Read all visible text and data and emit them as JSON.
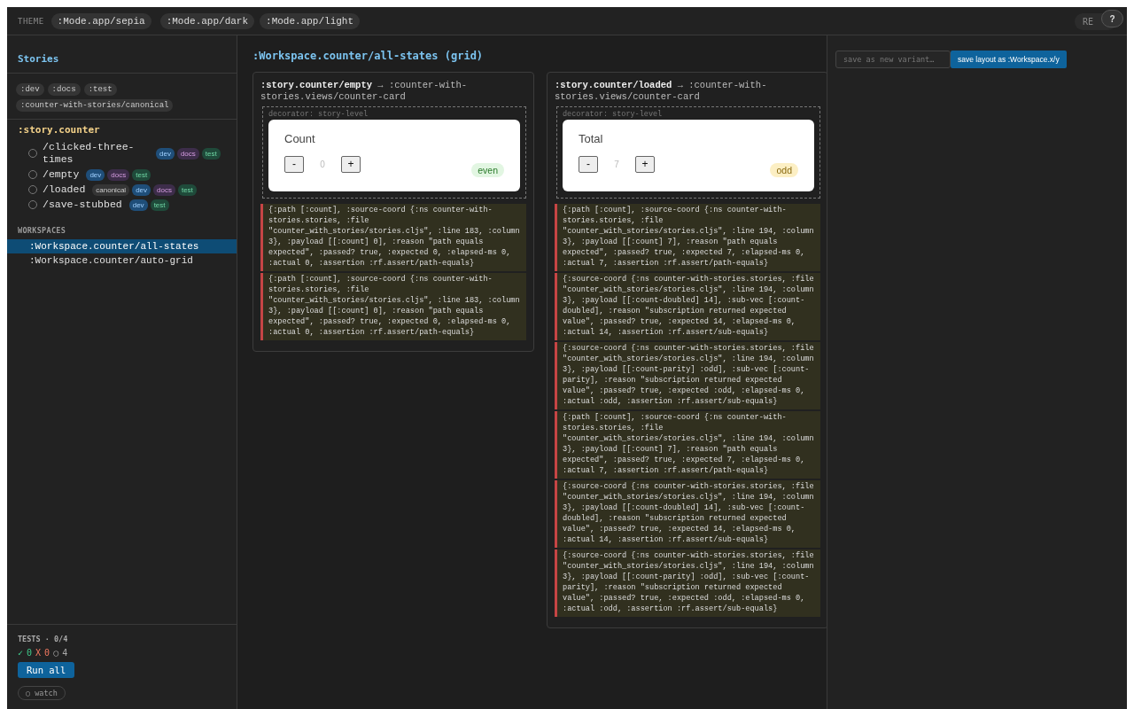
{
  "topbar": {
    "theme_label": "THEME",
    "modes": [
      ":Mode.app/sepia",
      ":Mode.app/dark",
      ":Mode.app/light"
    ],
    "re_button": "RE",
    "help_button": "?"
  },
  "sidebar": {
    "title": "Stories",
    "tags": [
      ":dev",
      ":docs",
      ":test",
      ":counter-with-stories/canonical"
    ],
    "group": ":story.counter",
    "stories": [
      {
        "name": "/clicked-three-times",
        "selected": false,
        "tags": [
          {
            "label": "dev",
            "kind": "dev"
          },
          {
            "label": "docs",
            "kind": "docs"
          },
          {
            "label": "test",
            "kind": "test"
          }
        ]
      },
      {
        "name": "/empty",
        "selected": false,
        "tags": [
          {
            "label": "dev",
            "kind": "dev"
          },
          {
            "label": "docs",
            "kind": "docs"
          },
          {
            "label": "test",
            "kind": "test"
          }
        ]
      },
      {
        "name": "/loaded",
        "selected": false,
        "tags": [
          {
            "label": "canonical",
            "kind": "canonical"
          },
          {
            "label": "dev",
            "kind": "dev"
          },
          {
            "label": "docs",
            "kind": "docs"
          },
          {
            "label": "test",
            "kind": "test"
          }
        ]
      },
      {
        "name": "/save-stubbed",
        "selected": false,
        "tags": [
          {
            "label": "dev",
            "kind": "dev"
          },
          {
            "label": "test",
            "kind": "test"
          }
        ]
      }
    ],
    "workspaces_label": "WORKSPACES",
    "workspaces": [
      {
        "label": ":Workspace.counter/all-states",
        "selected": true
      },
      {
        "label": ":Workspace.counter/auto-grid",
        "selected": false
      }
    ],
    "tests": {
      "title": "TESTS · 0/4",
      "counts": [
        {
          "kind": "pass",
          "symbol": "✓",
          "count": "0"
        },
        {
          "kind": "fail",
          "symbol": "X",
          "count": "0"
        },
        {
          "kind": "pending",
          "symbol": "○",
          "count": "4"
        }
      ],
      "run_button": "Run all",
      "watch_button": "○ watch"
    }
  },
  "main": {
    "title": ":Workspace.counter/all-states (grid)",
    "cards": [
      {
        "heading": "**:story.counter/empty** → :counter-with-stories.views/counter-card",
        "decorator": "decorator: story-level",
        "counter": {
          "label": "Count",
          "minus": "-",
          "value": "0",
          "plus": "+",
          "parity": "even",
          "kind": "even"
        },
        "logs": [
          "{:path [:count], :source-coord {:ns counter-with-stories.stories, :file \"counter_with_stories/stories.cljs\", :line 183, :column 3}, :payload [[:count] 0], :reason \"path equals expected\", :passed? true, :expected 0, :elapsed-ms 0, :actual 0, :assertion :rf.assert/path-equals}",
          "{:path [:count], :source-coord {:ns counter-with-stories.stories, :file \"counter_with_stories/stories.cljs\", :line 183, :column 3}, :payload [[:count] 0], :reason \"path equals expected\", :passed? true, :expected 0, :elapsed-ms 0, :actual 0, :assertion :rf.assert/path-equals}"
        ]
      },
      {
        "heading": "**:story.counter/loaded** → :counter-with-stories.views/counter-card",
        "decorator": "decorator: story-level",
        "counter": {
          "label": "Total",
          "minus": "-",
          "value": "7",
          "plus": "+",
          "parity": "odd",
          "kind": "odd"
        },
        "logs": [
          "{:path [:count], :source-coord {:ns counter-with-stories.stories, :file \"counter_with_stories/stories.cljs\", :line 194, :column 3}, :payload [[:count] 7], :reason \"path equals expected\", :passed? true, :expected 7, :elapsed-ms 0, :actual 7, :assertion :rf.assert/path-equals}",
          "{:source-coord {:ns counter-with-stories.stories, :file \"counter_with_stories/stories.cljs\", :line 194, :column 3}, :payload [[:count-doubled] 14], :sub-vec [:count-doubled], :reason \"subscription returned expected value\", :passed? true, :expected 14, :elapsed-ms 0, :actual 14, :assertion :rf.assert/sub-equals}",
          "{:source-coord {:ns counter-with-stories.stories, :file \"counter_with_stories/stories.cljs\", :line 194, :column 3}, :payload [[:count-parity] :odd], :sub-vec [:count-parity], :reason \"subscription returned expected value\", :passed? true, :expected :odd, :elapsed-ms 0, :actual :odd, :assertion :rf.assert/sub-equals}",
          "{:path [:count], :source-coord {:ns counter-with-stories.stories, :file \"counter_with_stories/stories.cljs\", :line 194, :column 3}, :payload [[:count] 7], :reason \"path equals expected\", :passed? true, :expected 7, :elapsed-ms 0, :actual 7, :assertion :rf.assert/path-equals}",
          "{:source-coord {:ns counter-with-stories.stories, :file \"counter_with_stories/stories.cljs\", :line 194, :column 3}, :payload [[:count-doubled] 14], :sub-vec [:count-doubled], :reason \"subscription returned expected value\", :passed? true, :expected 14, :elapsed-ms 0, :actual 14, :assertion :rf.assert/sub-equals}",
          "{:source-coord {:ns counter-with-stories.stories, :file \"counter_with_stories/stories.cljs\", :line 194, :column 3}, :payload [[:count-parity] :odd], :sub-vec [:count-parity], :reason \"subscription returned expected value\", :passed? true, :expected :odd, :elapsed-ms 0, :actual :odd, :assertion :rf.assert/sub-equals}"
        ]
      }
    ]
  },
  "right_panel": {
    "variant_placeholder": "save as new variant…",
    "save_button": "save layout as :Workspace.x/y"
  }
}
